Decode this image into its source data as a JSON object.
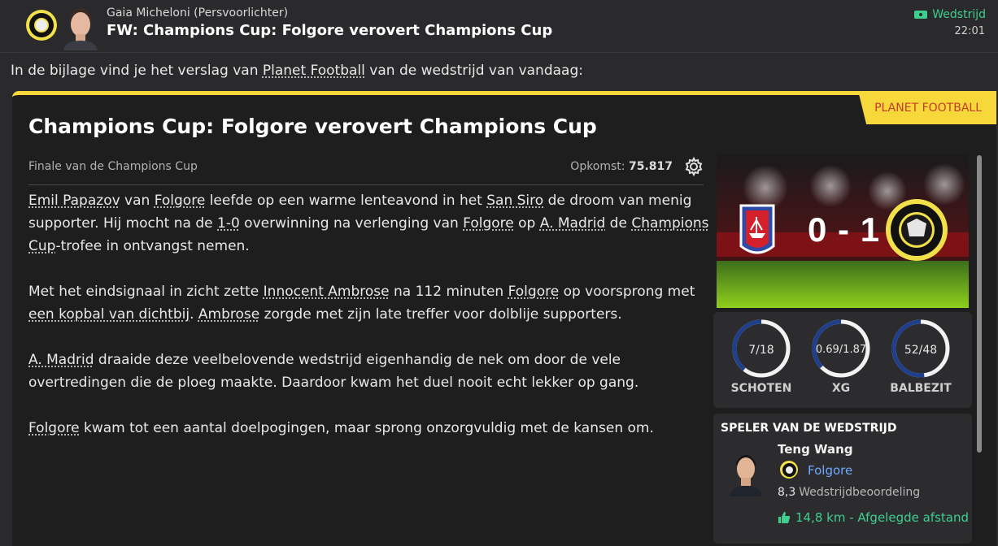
{
  "header": {
    "sender": "Gaia Micheloni  (Persvoorlichter)",
    "subject": "FW: Champions Cup: Folgore verovert Champions Cup",
    "tag": "Wedstrijd",
    "time": "22:01"
  },
  "intro": {
    "before": "In de bijlage vind je het verslag van ",
    "source_link": "Planet Football",
    "after": " van de wedstrijd van vandaag:"
  },
  "article": {
    "source_tag": "PLANET FOOTBALL",
    "title": "Champions Cup: Folgore verovert Champions Cup",
    "competition": "Finale van de Champions Cup",
    "attendance_label": "Opkomst:",
    "attendance_value": "75.817",
    "p1": {
      "player": "Emil Papazov",
      "t1": " van ",
      "club": "Folgore",
      "t2": " leefde op een warme lenteavond in het ",
      "stadium": "San Siro",
      "t3": " de droom van menig supporter. Hij mocht na de ",
      "score": "1-0",
      "t4": " overwinning na verlenging van ",
      "club2": "Folgore",
      "t5": " op ",
      "opponent": "A. Madrid",
      "t6": " de ",
      "comp1": "Champions Cup",
      "t7": "-trofee in ontvangst nemen."
    },
    "p2": {
      "t1": "Met het eindsignaal in zicht zette ",
      "scorer": "Innocent Ambrose",
      "t2": " na 112 minuten ",
      "club": "Folgore",
      "t3": " op voorsprong met ",
      "goal_type": "een kopbal van dichtbij",
      "t4": ". ",
      "scorer_short": "Ambrose",
      "t5": " zorgde met zijn late treffer voor dolblije supporters."
    },
    "p3": {
      "opponent": "A. Madrid",
      "t1": " draaide deze veelbelovende wedstrijd eigenhandig de nek om door de vele overtredingen die de ploeg maakte. Daardoor kwam het duel nooit echt lekker op gang."
    },
    "p4": {
      "club": "Folgore",
      "t1": " kwam tot een aantal doelpogingen, maar sprong onzorgvuldig met de kansen om."
    }
  },
  "score": {
    "home": "0",
    "sep": "-",
    "away": "1"
  },
  "stats": [
    {
      "label": "SCHOTEN",
      "value": "7/18",
      "fraction": 0.39
    },
    {
      "label": "XG",
      "value": "0.69/1.87",
      "fraction": 0.37
    },
    {
      "label": "BALBEZIT",
      "value": "52/48",
      "fraction": 0.52
    }
  ],
  "potm": {
    "title": "SPELER VAN DE WEDSTRIJD",
    "name": "Teng Wang",
    "club": "Folgore",
    "rating": "8,3",
    "rating_label": "Wedstrijdbeoordeling",
    "distance": "14,8 km - Afgelegde afstand"
  },
  "colors": {
    "accent_yellow": "#f6d83a",
    "green": "#3ecf8e",
    "link_blue": "#6fa8ff",
    "stat_blue": "#1f3f8c"
  }
}
